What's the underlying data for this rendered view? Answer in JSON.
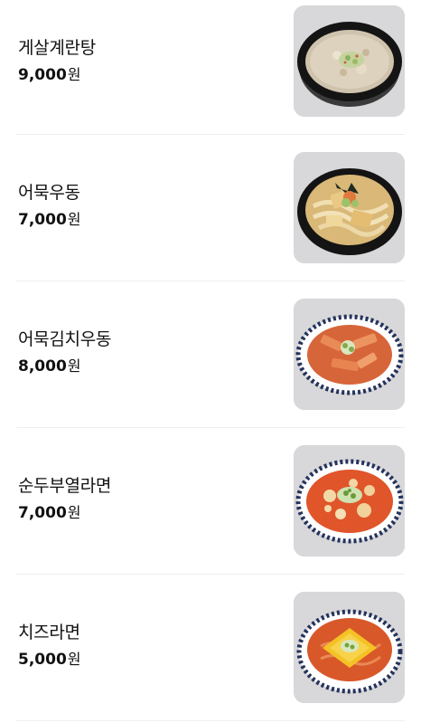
{
  "menu": {
    "items": [
      {
        "name": "게살계란탕",
        "price": "9,000",
        "unit": "원",
        "image": "crab-egg-soup-photo"
      },
      {
        "name": "어묵우동",
        "price": "7,000",
        "unit": "원",
        "image": "fishcake-udon-photo"
      },
      {
        "name": "어묵김치우동",
        "price": "8,000",
        "unit": "원",
        "image": "fishcake-kimchi-udon-photo"
      },
      {
        "name": "순두부열라면",
        "price": "7,000",
        "unit": "원",
        "image": "soft-tofu-yeol-ramen-photo"
      },
      {
        "name": "치즈라면",
        "price": "5,000",
        "unit": "원",
        "image": "cheese-ramen-photo"
      }
    ]
  },
  "colors": {
    "text": "#111111",
    "divider": "#eeeeee",
    "photo_background": "#d7d6d8"
  }
}
